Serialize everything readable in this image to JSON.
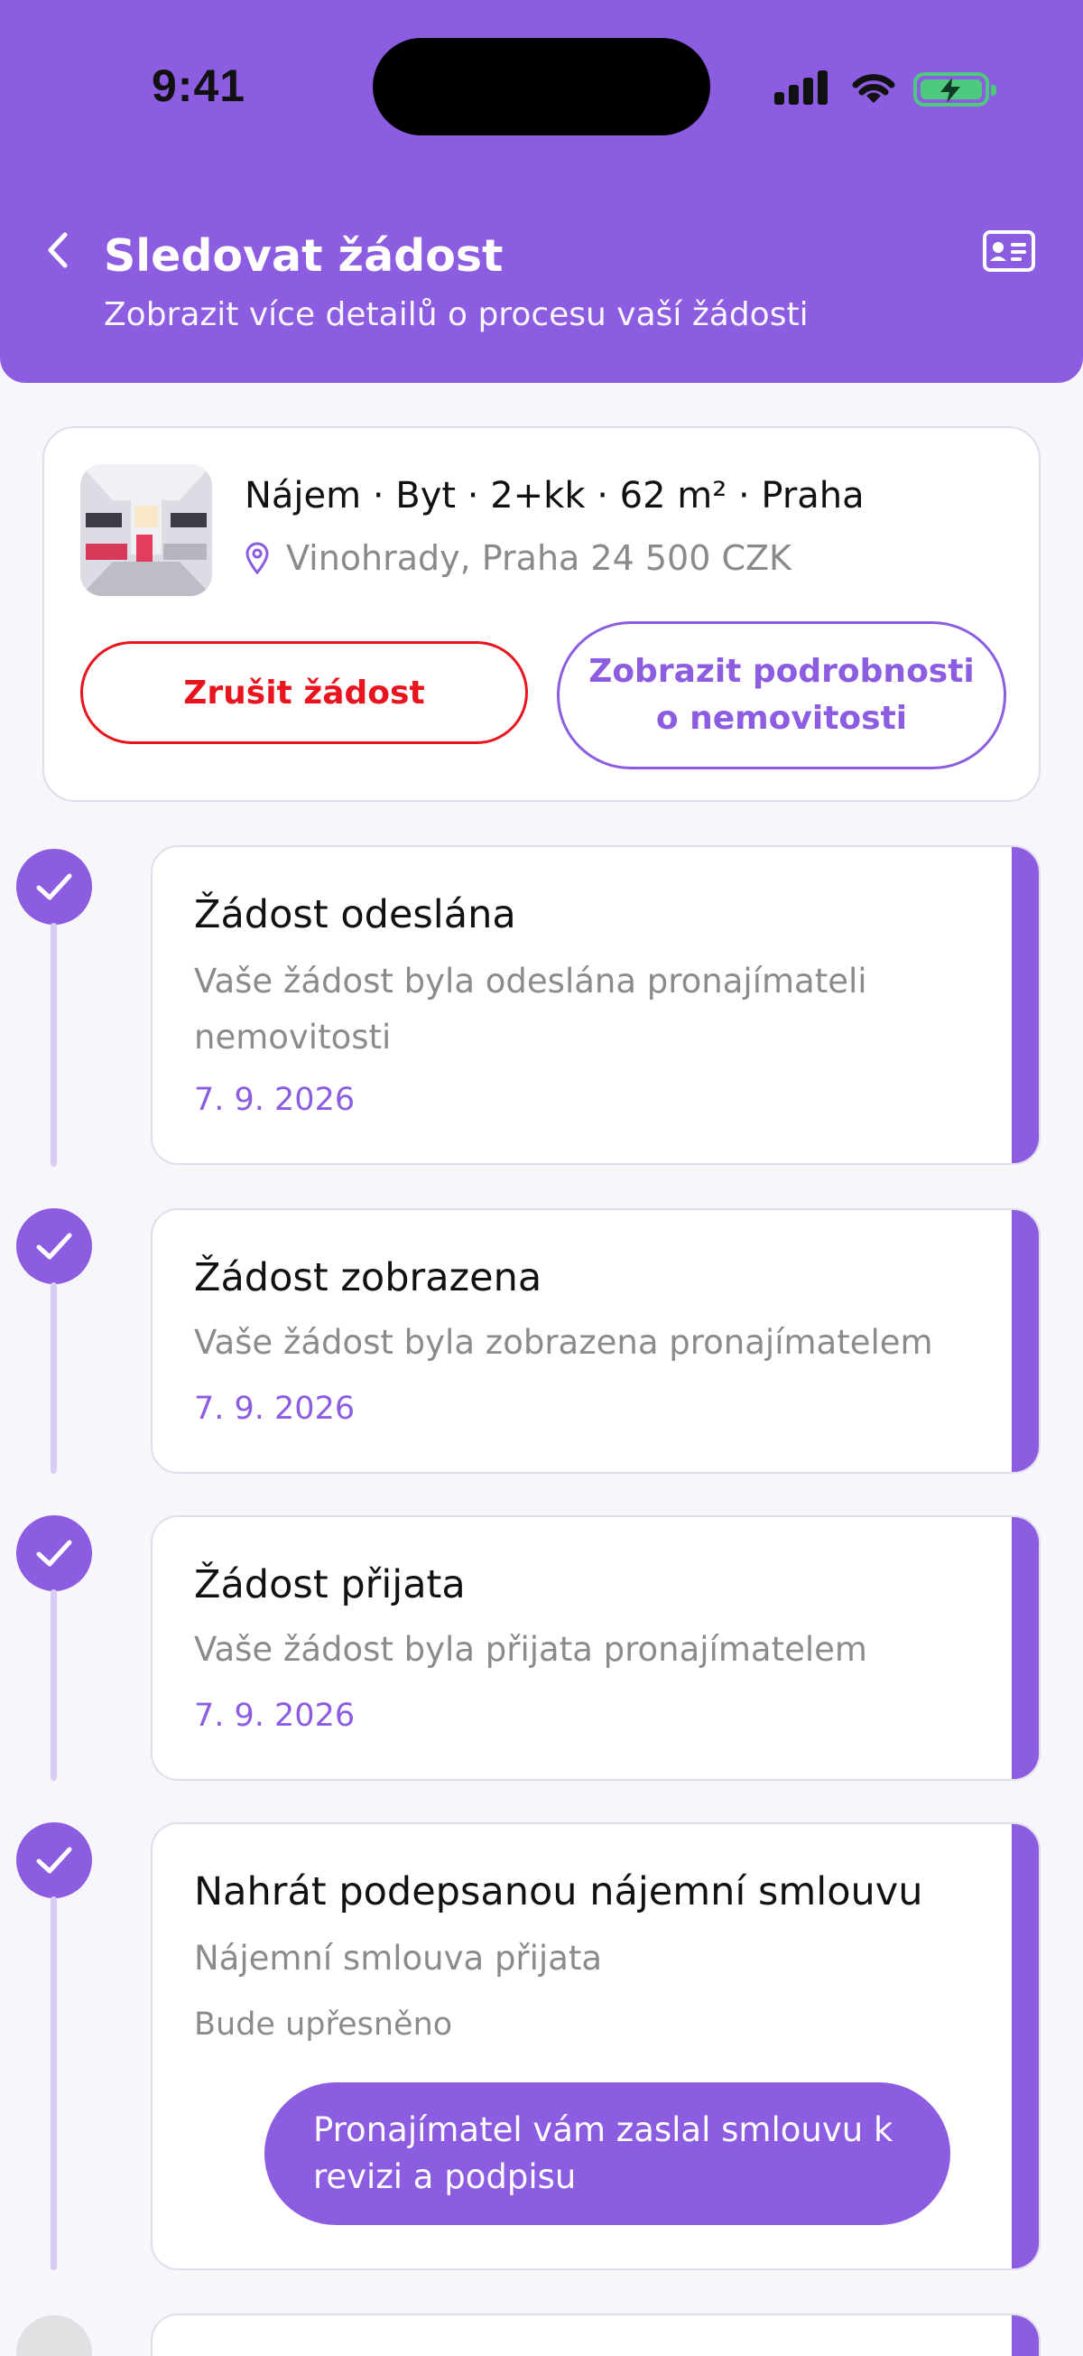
{
  "status_bar": {
    "time": "9:41"
  },
  "header": {
    "title": "Sledovat žádost",
    "subtitle": "Zobrazit více detailů o procesu vaší žádosti",
    "back_icon": "chevron-left-icon",
    "right_icon": "id-card-icon"
  },
  "property": {
    "title": "Nájem · Byt · 2+kk · 62 m² · Praha",
    "location": "Vinohrady, Praha 24 500 CZK",
    "cancel_label": "Zrušit žádost",
    "details_label": "Zobrazit podrobnosti o nemovitosti"
  },
  "steps": [
    {
      "title": "Žádost odeslána",
      "description": "Vaše žádost byla odeslána pronajímateli nemovitosti",
      "date": "7. 9. 2026",
      "done": true
    },
    {
      "title": "Žádost zobrazena",
      "description": "Vaše žádost byla zobrazena pronajímatelem",
      "date": "7. 9. 2026",
      "done": true
    },
    {
      "title": "Žádost přijata",
      "description": "Vaše žádost byla přijata pronajímatelem",
      "date": "7. 9. 2026",
      "done": true
    },
    {
      "title": "Nahrát podepsanou nájemní smlouvu",
      "description": "Nájemní smlouva přijata",
      "note": "Bude upřesněno",
      "action_label": "Pronajímatel vám zaslal smlouvu k revizi a podpisu",
      "done": true
    },
    {
      "done": false
    }
  ],
  "colors": {
    "primary": "#8c5ce1",
    "danger": "#e8141e",
    "line": "#d9cbf6",
    "background": "#f7f6fb"
  }
}
